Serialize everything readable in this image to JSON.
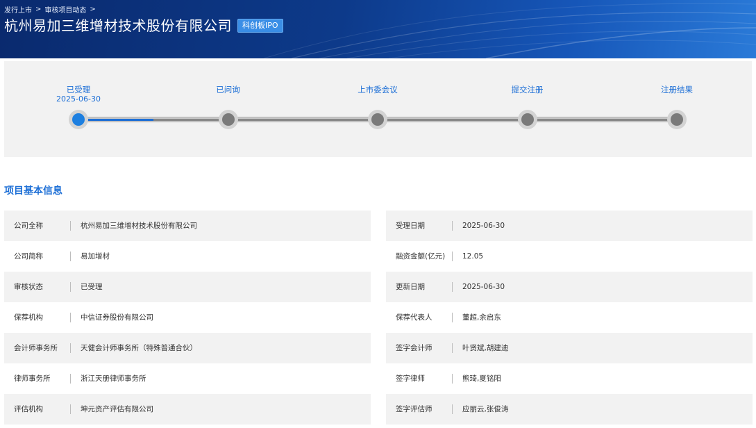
{
  "breadcrumb": [
    "发行上市",
    "审核项目动态"
  ],
  "header": {
    "title": "杭州易加三维增材技术股份有限公司",
    "tag": "科创板IPO"
  },
  "progress": {
    "steps": [
      {
        "label": "已受理",
        "date": "2025-06-30",
        "active": true
      },
      {
        "label": "已问询",
        "date": "",
        "active": false
      },
      {
        "label": "上市委会议",
        "date": "",
        "active": false
      },
      {
        "label": "提交注册",
        "date": "",
        "active": false
      },
      {
        "label": "注册结果",
        "date": "",
        "active": false
      }
    ],
    "completed_fraction": 0.125
  },
  "section": {
    "title": "项目基本信息"
  },
  "info_left": [
    {
      "label": "公司全称",
      "value": "杭州易加三维增材技术股份有限公司"
    },
    {
      "label": "公司简称",
      "value": "易加增材"
    },
    {
      "label": "审核状态",
      "value": "已受理"
    },
    {
      "label": "保荐机构",
      "value": "中信证券股份有限公司"
    },
    {
      "label": "会计师事务所",
      "value": "天健会计师事务所（特殊普通合伙）"
    },
    {
      "label": "律师事务所",
      "value": "浙江天册律师事务所"
    },
    {
      "label": "评估机构",
      "value": "坤元资产评估有限公司"
    }
  ],
  "info_right": [
    {
      "label": "受理日期",
      "value": "2025-06-30"
    },
    {
      "label": "融资金额(亿元)",
      "value": "12.05"
    },
    {
      "label": "更新日期",
      "value": "2025-06-30"
    },
    {
      "label": "保荐代表人",
      "value": "董超,余启东"
    },
    {
      "label": "签字会计师",
      "value": "叶贤斌,胡建迪"
    },
    {
      "label": "签字律师",
      "value": "熊琦,夏铭阳"
    },
    {
      "label": "签字评估师",
      "value": "应丽云,张俊涛"
    }
  ],
  "icons": {
    "breadcrumb_separator": "chevron-right-icon"
  },
  "colors": {
    "accent": "#1d6fd6",
    "banner": "#0d3a8a",
    "panel": "#f2f2f2"
  }
}
